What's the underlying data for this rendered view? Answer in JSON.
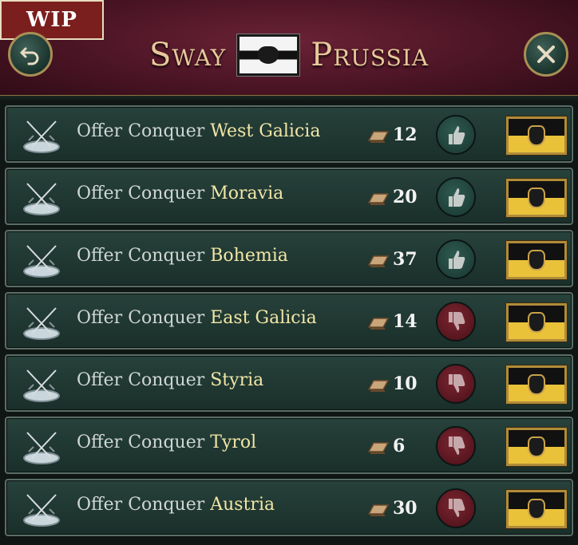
{
  "badge": "WIP",
  "title": {
    "left": "Sway",
    "right": "Prussia"
  },
  "colors": {
    "header_bg": "#4a1424",
    "row_bg": "#27413b",
    "title_gold": "#e8c89a",
    "province_text": "#f1e6a6",
    "approve_green": "#2f5a4f",
    "reject_red": "#7a2630"
  },
  "icons": {
    "back": "undo-arrow-icon",
    "close": "close-x-icon",
    "row": "crossed-swords-icon",
    "cost": "influence-scroll-icon",
    "approve": "thumbs-up-icon",
    "reject": "thumbs-down-icon"
  },
  "rows": [
    {
      "action": "Offer Conquer",
      "province": "West Galicia",
      "cost": "12",
      "vote": "approve"
    },
    {
      "action": "Offer Conquer",
      "province": "Moravia",
      "cost": "20",
      "vote": "approve"
    },
    {
      "action": "Offer Conquer",
      "province": "Bohemia",
      "cost": "37",
      "vote": "approve"
    },
    {
      "action": "Offer Conquer",
      "province": "East Galicia",
      "cost": "14",
      "vote": "reject"
    },
    {
      "action": "Offer Conquer",
      "province": "Styria",
      "cost": "10",
      "vote": "reject"
    },
    {
      "action": "Offer Conquer",
      "province": "Tyrol",
      "cost": "6",
      "vote": "reject"
    },
    {
      "action": "Offer Conquer",
      "province": "Austria",
      "cost": "30",
      "vote": "reject"
    }
  ]
}
